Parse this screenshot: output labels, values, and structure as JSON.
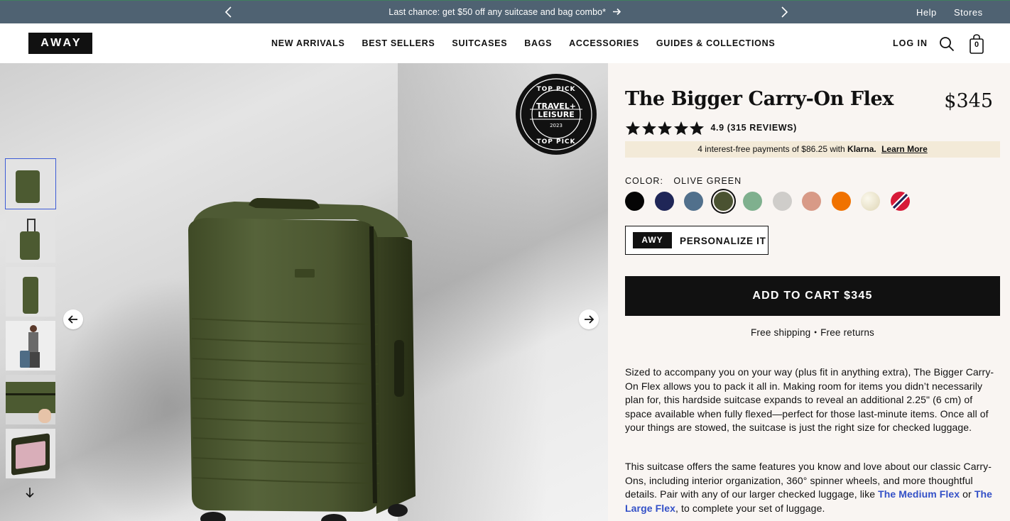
{
  "announcement": {
    "promo": "Last chance: get $50 off any suitcase and bag combo*",
    "help": "Help",
    "stores": "Stores"
  },
  "header": {
    "logo": "AWAY",
    "nav": [
      "NEW ARRIVALS",
      "BEST SELLERS",
      "SUITCASES",
      "BAGS",
      "ACCESSORIES",
      "GUIDES & COLLECTIONS"
    ],
    "login": "LOG IN",
    "cart_count": "0"
  },
  "gallery": {
    "badge": {
      "top_text": "TOP PICK",
      "line1": "TRAVEL+",
      "line2": "LEISURE",
      "year": "2023",
      "bottom_text": "TOP PICK"
    },
    "thumbnail_count": 6
  },
  "product": {
    "title": "The Bigger Carry-On Flex",
    "price": "$345",
    "rating_stars": 5,
    "rating_text": "4.9 (315 REVIEWS)",
    "klarna": {
      "text": "4 interest-free payments of $86.25 with",
      "brand": "Klarna.",
      "link": "Learn More"
    },
    "color_label": "COLOR:",
    "color_value": "OLIVE GREEN",
    "swatches": [
      {
        "name": "black",
        "color": "#050505"
      },
      {
        "name": "navy",
        "color": "#1f2657"
      },
      {
        "name": "slate-blue",
        "color": "#51708c"
      },
      {
        "name": "olive-green",
        "color": "#4a5231",
        "selected": true
      },
      {
        "name": "sage",
        "color": "#7fb08e"
      },
      {
        "name": "light-grey",
        "color": "#cfcdca"
      },
      {
        "name": "terracotta",
        "color": "#d89a87"
      },
      {
        "name": "orange",
        "color": "#f07200"
      },
      {
        "name": "pearl",
        "color": "#e7e0c6"
      },
      {
        "name": "stripe-red-navy",
        "color": "#d71a38"
      }
    ],
    "personalize_badge": "AWY",
    "personalize_label": "PERSONALIZE IT",
    "add_to_cart": "ADD TO CART $345",
    "shipping": "Free shipping・Free returns",
    "description_1": "Sized to accompany you on your way (plus fit in anything extra), The Bigger Carry-On Flex allows you to pack it all in. Making room for items you didn’t necessarily plan for, this hardside suitcase expands to reveal an additional 2.25\" (6 cm) of space available when fully flexed—perfect for those last-minute items. Once all of your things are stowed, the suitcase is just the right size for checked luggage.",
    "description_2_before": "This suitcase offers the same features you know and love about our classic Carry-Ons, including interior organization, 360° spinner wheels, and more thoughtful details. Pair with any of our larger checked luggage, like ",
    "description_2_link1": "The Medium Flex",
    "description_2_mid": " or ",
    "description_2_link2": "The Large Flex",
    "description_2_after": ", to complete your set of luggage."
  }
}
